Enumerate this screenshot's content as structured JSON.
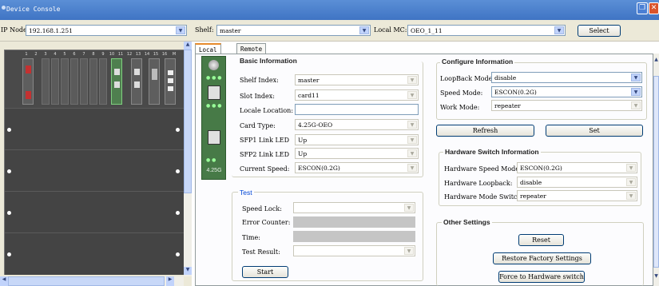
{
  "window": {
    "title": "Device Console"
  },
  "toolbar": {
    "ip_label": "IP Node",
    "ip_value": "192.168.1.251",
    "shelf_label": "Shelf:",
    "shelf_value": "master",
    "mc_label": "Local MC:",
    "mc_value": "OEO_1_11",
    "select_label": "Select"
  },
  "chassis": {
    "slot_numbers": [
      "1",
      "2",
      "3",
      "4",
      "5",
      "6",
      "7",
      "8",
      "9",
      "10",
      "11",
      "12",
      "13",
      "14",
      "15",
      "16",
      "M"
    ]
  },
  "tabs": [
    "Local Card",
    "Remote Card"
  ],
  "card": {
    "badge": "4.25G"
  },
  "basic": {
    "title": "Basic Information",
    "shelf_index_label": "Shelf Index:",
    "shelf_index_value": "master",
    "slot_index_label": "Slot Index:",
    "slot_index_value": "card11",
    "locale_label": "Locale Location:",
    "locale_value": "",
    "card_type_label": "Card Type:",
    "card_type_value": "4.25G-OEO",
    "sfp1_label": "SFP1 Link LED",
    "sfp1_value": "Up",
    "sfp2_label": "SFP2 Link LED",
    "sfp2_value": "Up",
    "speed_label": "Current Speed:",
    "speed_value": "ESCON(0.2G)"
  },
  "test": {
    "title": "Test",
    "speed_lock_label": "Speed Lock:",
    "error_counter_label": "Error Counter:",
    "time_label": "Time:",
    "result_label": "Test Result:",
    "start_label": "Start"
  },
  "configure": {
    "title": "Configure Information",
    "loopback_label": "LoopBack Mode:",
    "loopback_value": "disable",
    "speed_mode_label": "Speed Mode:",
    "speed_mode_value": "ESCON(0.2G)",
    "work_mode_label": "Work Mode:",
    "work_mode_value": "repeater",
    "refresh_label": "Refresh",
    "set_label": "Set"
  },
  "hardware": {
    "title": "Hardware Switch Information",
    "speed_label": "Hardware Speed Mode:",
    "speed_value": "ESCON(0.2G)",
    "loopback_label": "Hardware Loopback:",
    "loopback_value": "disable",
    "mode_label": "Hardware Mode Switch:",
    "mode_value": "repeater"
  },
  "other": {
    "title": "Other Settings",
    "reset_label": "Reset",
    "restore_label": "Restore Factory Settings",
    "force_label": "Force to Hardware switch"
  },
  "colors": {
    "titlebar": "#3f74c4",
    "card_green": "#477a47",
    "tab_accent": "#e68b2c"
  }
}
